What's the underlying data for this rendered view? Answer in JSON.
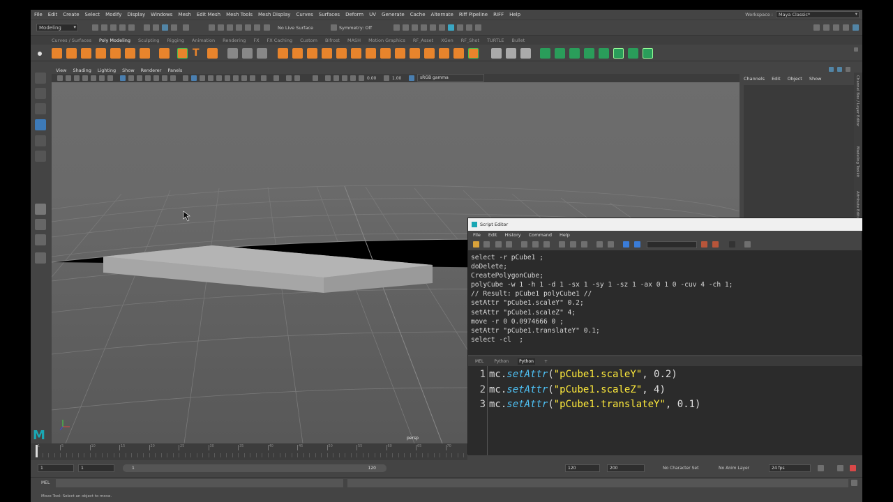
{
  "menubar": {
    "items": [
      "File",
      "Edit",
      "Create",
      "Select",
      "Modify",
      "Display",
      "Windows",
      "Mesh",
      "Edit Mesh",
      "Mesh Tools",
      "Mesh Display",
      "Curves",
      "Surfaces",
      "Deform",
      "UV",
      "Generate",
      "Cache",
      "Alternate",
      "Riff Pipeline",
      "RIFF",
      "Help"
    ],
    "workspace_label": "Workspace :",
    "workspace_value": "Maya Classic*"
  },
  "statusline": {
    "mode": "Modeling",
    "live_surface": "No Live Surface",
    "symmetry": "Symmetry: Off"
  },
  "shelf": {
    "tabs": [
      "Curves / Surfaces",
      "Poly Modeling",
      "Sculpting",
      "Rigging",
      "Animation",
      "Rendering",
      "FX",
      "FX Caching",
      "Custom",
      "Bifrost",
      "MASH",
      "Motion Graphics",
      "RF_Asset",
      "XGen",
      "RF_Shot",
      "TURTLE",
      "Bullet"
    ],
    "active_tab": "Poly Modeling"
  },
  "viewport": {
    "menu": [
      "View",
      "Shading",
      "Lighting",
      "Show",
      "Renderer",
      "Panels"
    ],
    "exposure": "0.00",
    "gamma": "1.00",
    "colorspace": "sRGB gamma",
    "camera_label": "persp"
  },
  "channelbox": {
    "menu": [
      "Channels",
      "Edit",
      "Object",
      "Show"
    ],
    "side_tabs": [
      "Channel Box / Layer Editor",
      "Modeling Toolkit",
      "Attribute Editor"
    ]
  },
  "script_editor": {
    "title": "Script Editor",
    "menu": [
      "File",
      "Edit",
      "History",
      "Command",
      "Help"
    ],
    "history": "select -r pCube1 ;\ndoDelete;\nCreatePolygonCube;\npolyCube -w 1 -h 1 -d 1 -sx 1 -sy 1 -sz 1 -ax 0 1 0 -cuv 4 -ch 1;\n// Result: pCube1 polyCube1 //\nsetAttr \"pCube1.scaleY\" 0.2;\nsetAttr \"pCube1.scaleZ\" 4;\nmove -r 0 0.0974666 0 ;\nsetAttr \"pCube1.translateY\" 0.1;\nselect -cl  ;",
    "tabs": [
      "MEL",
      "Python",
      "Python",
      "+"
    ],
    "active_tab_index": 2,
    "code_lines": [
      {
        "num": "1",
        "obj": "mc.",
        "fn": "setAttr",
        "open": "(",
        "str": "\"pCube1.scaleY\"",
        "rest": ", 0.2)"
      },
      {
        "num": "2",
        "obj": "mc.",
        "fn": "setAttr",
        "open": "(",
        "str": "\"pCube1.scaleZ\"",
        "rest": ", 4)"
      },
      {
        "num": "3",
        "obj": "mc.",
        "fn": "setAttr",
        "open": "(",
        "str": "\"pCube1.translateY\"",
        "rest": ", 0.1)"
      }
    ]
  },
  "timeline": {
    "ticks": [
      "1",
      "5",
      "10",
      "15",
      "20",
      "25",
      "30",
      "35",
      "40",
      "45",
      "50",
      "55",
      "60",
      "65",
      "70"
    ]
  },
  "range": {
    "start": "1",
    "playback_start": "1",
    "slider_start": "1",
    "slider_end": "120",
    "playback_end": "120",
    "end": "200",
    "character_set": "No Character Set",
    "anim_layer": "No Anim Layer",
    "fps": "24 fps"
  },
  "cmdline": {
    "lang": "MEL"
  },
  "helpline": {
    "text": "Move Tool: Select an object to move."
  }
}
